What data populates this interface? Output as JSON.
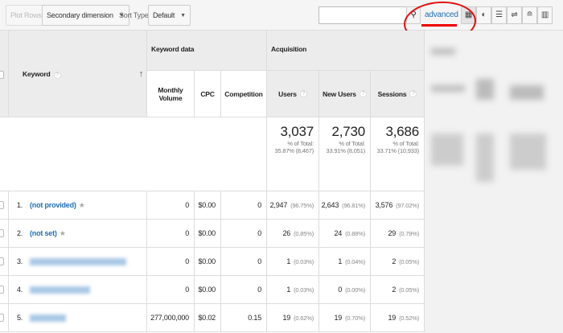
{
  "toolbar": {
    "plot_rows": "Plot Rows",
    "secondary_dimension": "Secondary dimension",
    "sort_type_label": "Sort Type:",
    "sort_type_value": "Default",
    "search_value": "",
    "advanced": "advanced",
    "view_icons": [
      "table-icon",
      "pie-icon",
      "performance-icon",
      "comparison-icon",
      "term-cloud-icon",
      "pivot-icon"
    ]
  },
  "table": {
    "keyword_header": "Keyword",
    "group_keyword_data": "Keyword data",
    "group_acquisition": "Acquisition",
    "columns": [
      "Monthly Volume",
      "CPC",
      "Competition",
      "Users",
      "New Users",
      "Sessions"
    ],
    "totals": {
      "users": {
        "value": "3,037",
        "label": "% of Total:",
        "detail": "35.87% (8,467)"
      },
      "new_users": {
        "value": "2,730",
        "label": "% of Total:",
        "detail": "33.91% (8,051)"
      },
      "sessions": {
        "value": "3,686",
        "label": "% of Total:",
        "detail": "33.71% (10,933)"
      }
    },
    "rows": [
      {
        "n": "1.",
        "keyword": "(not provided)",
        "volume": "0",
        "cpc": "$0.00",
        "competition": "0",
        "users": "2,947",
        "users_pct": "(96.75%)",
        "new_users": "2,643",
        "new_users_pct": "(96.81%)",
        "sessions": "3,576",
        "sessions_pct": "(97.02%)"
      },
      {
        "n": "2.",
        "keyword": "(not set)",
        "volume": "0",
        "cpc": "$0.00",
        "competition": "0",
        "users": "26",
        "users_pct": "(0.85%)",
        "new_users": "24",
        "new_users_pct": "(0.88%)",
        "sessions": "29",
        "sessions_pct": "(0.79%)"
      },
      {
        "n": "3.",
        "keyword": "",
        "volume": "0",
        "cpc": "$0.00",
        "competition": "0",
        "users": "1",
        "users_pct": "(0.03%)",
        "new_users": "1",
        "new_users_pct": "(0.04%)",
        "sessions": "2",
        "sessions_pct": "(0.05%)"
      },
      {
        "n": "4.",
        "keyword": "",
        "volume": "0",
        "cpc": "$0.00",
        "competition": "0",
        "users": "1",
        "users_pct": "(0.03%)",
        "new_users": "0",
        "new_users_pct": "(0.00%)",
        "sessions": "2",
        "sessions_pct": "(0.05%)"
      },
      {
        "n": "5.",
        "keyword": "",
        "volume": "277,000,000",
        "cpc": "$0.02",
        "competition": "0.15",
        "users": "19",
        "users_pct": "(0.62%)",
        "new_users": "19",
        "new_users_pct": "(0.70%)",
        "sessions": "19",
        "sessions_pct": "(0.52%)"
      }
    ]
  },
  "colors": {
    "link": "#1f6fb5",
    "annotation": "#e01010"
  }
}
